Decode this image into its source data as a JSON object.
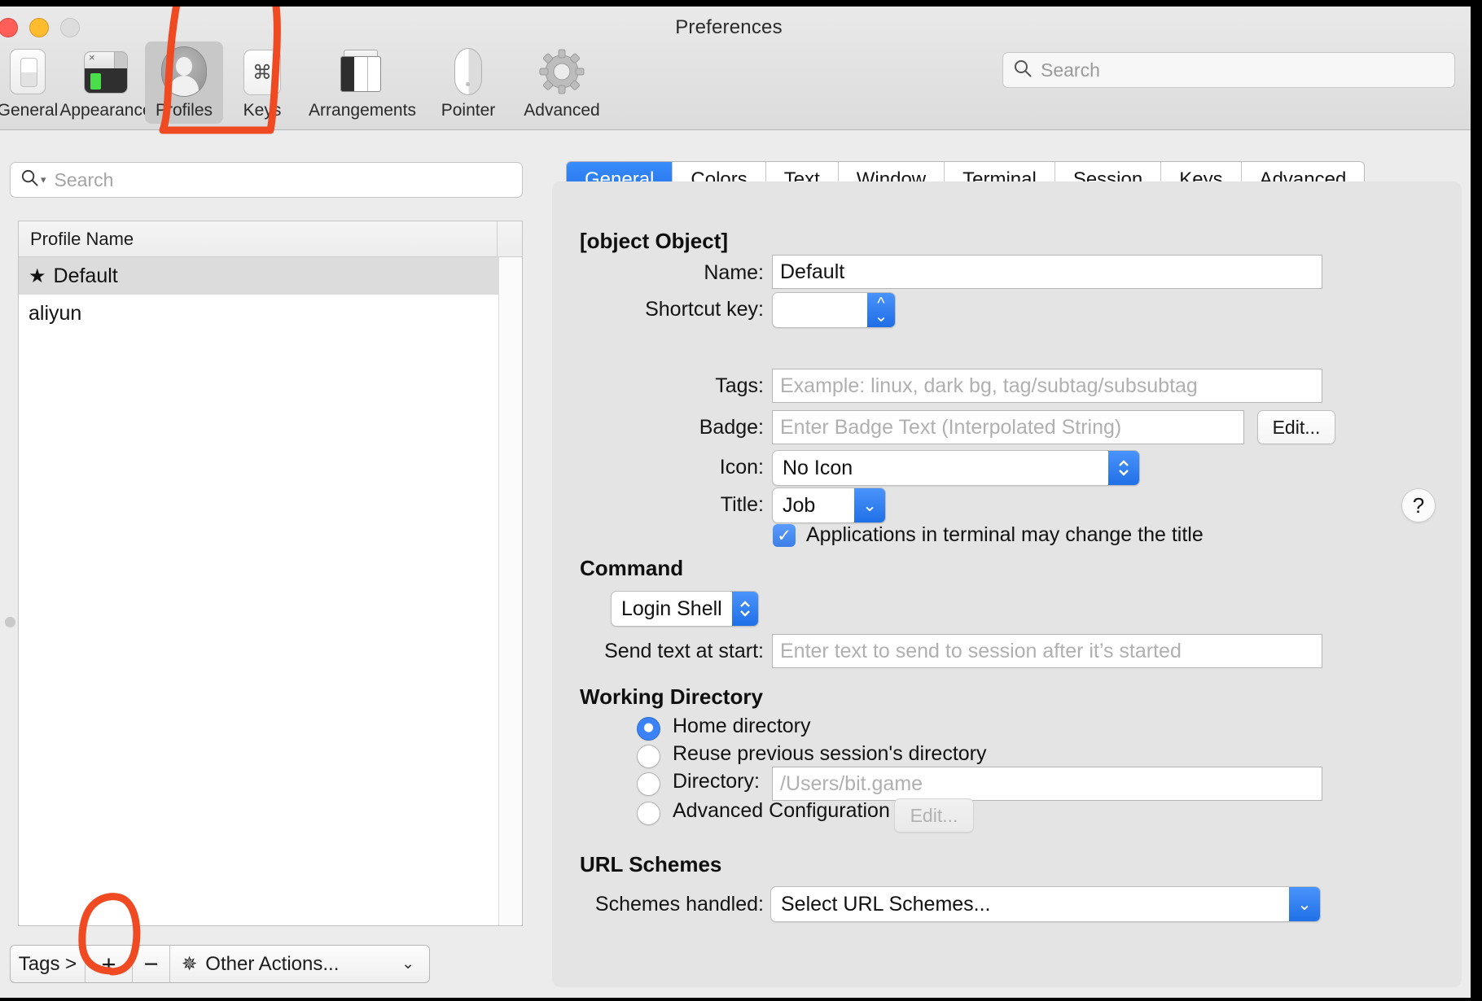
{
  "window": {
    "title": "Preferences"
  },
  "traffic": {
    "close": "close-button",
    "minimize": "minimize-button",
    "zoom": "zoom-button"
  },
  "toolbar": {
    "items": [
      {
        "label": "General",
        "icon": "general-switch-icon",
        "selected": false
      },
      {
        "label": "Appearance",
        "icon": "appearance-terminal-icon",
        "selected": false
      },
      {
        "label": "Profiles",
        "icon": "profiles-person-icon",
        "selected": true
      },
      {
        "label": "Keys",
        "icon": "keys-command-icon",
        "selected": false
      },
      {
        "label": "Arrangements",
        "icon": "arrangements-windows-icon",
        "selected": false
      },
      {
        "label": "Pointer",
        "icon": "pointer-mouse-icon",
        "selected": false
      },
      {
        "label": "Advanced",
        "icon": "advanced-gear-icon",
        "selected": false
      }
    ],
    "search": {
      "placeholder": "Search",
      "value": "",
      "icon": "search-icon"
    }
  },
  "sidebar": {
    "search": {
      "placeholder": "Search",
      "value": "",
      "icon": "search-icon"
    },
    "column_header": "Profile Name",
    "profiles": [
      {
        "name": "Default",
        "default": true,
        "star": "★",
        "selected": true
      },
      {
        "name": "aliyun",
        "default": false,
        "star": "",
        "selected": false
      }
    ],
    "bottom_bar": {
      "tags_label": "Tags >",
      "add_label": "+",
      "remove_label": "−",
      "other_actions_label": "Other Actions...",
      "other_actions_icon": "gear-icon",
      "chevron": "⌄"
    }
  },
  "detail": {
    "tabs": [
      {
        "label": "General",
        "active": true
      },
      {
        "label": "Colors",
        "active": false
      },
      {
        "label": "Text",
        "active": false
      },
      {
        "label": "Window",
        "active": false
      },
      {
        "label": "Terminal",
        "active": false
      },
      {
        "label": "Session",
        "active": false
      },
      {
        "label": "Keys",
        "active": false
      },
      {
        "label": "Advanced",
        "active": false
      }
    ],
    "sections": {
      "basics": {
        "title": {
          "label": "Title:",
          "value": "Job"
        },
        "name": {
          "label": "Name:",
          "value": "Default"
        },
        "shortcut_key": {
          "label": "Shortcut key:",
          "value": ""
        },
        "tags": {
          "label": "Tags:",
          "value": "",
          "placeholder": "Example: linux, dark bg, tag/subtag/subsubtag"
        },
        "badge": {
          "label": "Badge:",
          "value": "",
          "placeholder": "Enter Badge Text (Interpolated String)",
          "edit_label": "Edit..."
        },
        "icon": {
          "label": "Icon:",
          "value": "No Icon"
        },
        "help_label": "?",
        "apps_change_title": {
          "label": "Applications in terminal may change the title",
          "checked": true,
          "check_glyph": "✓"
        }
      },
      "command": {
        "title": "Command",
        "shell": {
          "value": "Login Shell"
        },
        "send_text": {
          "label": "Send text at start:",
          "value": "",
          "placeholder": "Enter text to send to session after it’s started"
        }
      },
      "working_directory": {
        "title": "Working Directory",
        "options": [
          {
            "label": "Home directory",
            "selected": true
          },
          {
            "label": "Reuse previous session's directory",
            "selected": false
          },
          {
            "label": "Directory:",
            "selected": false
          },
          {
            "label": "Advanced Configuration",
            "selected": false
          }
        ],
        "directory": {
          "value": "",
          "placeholder": "/Users/bit.game"
        },
        "advanced_edit_label": "Edit..."
      },
      "url_schemes": {
        "title": "URL Schemes",
        "schemes_handled": {
          "label": "Schemes handled:",
          "value": "Select URL Schemes..."
        }
      }
    }
  },
  "annotation": {
    "color": "#f04a23",
    "shapes": [
      "profiles-bracket-highlight",
      "plus-button-circle"
    ]
  }
}
